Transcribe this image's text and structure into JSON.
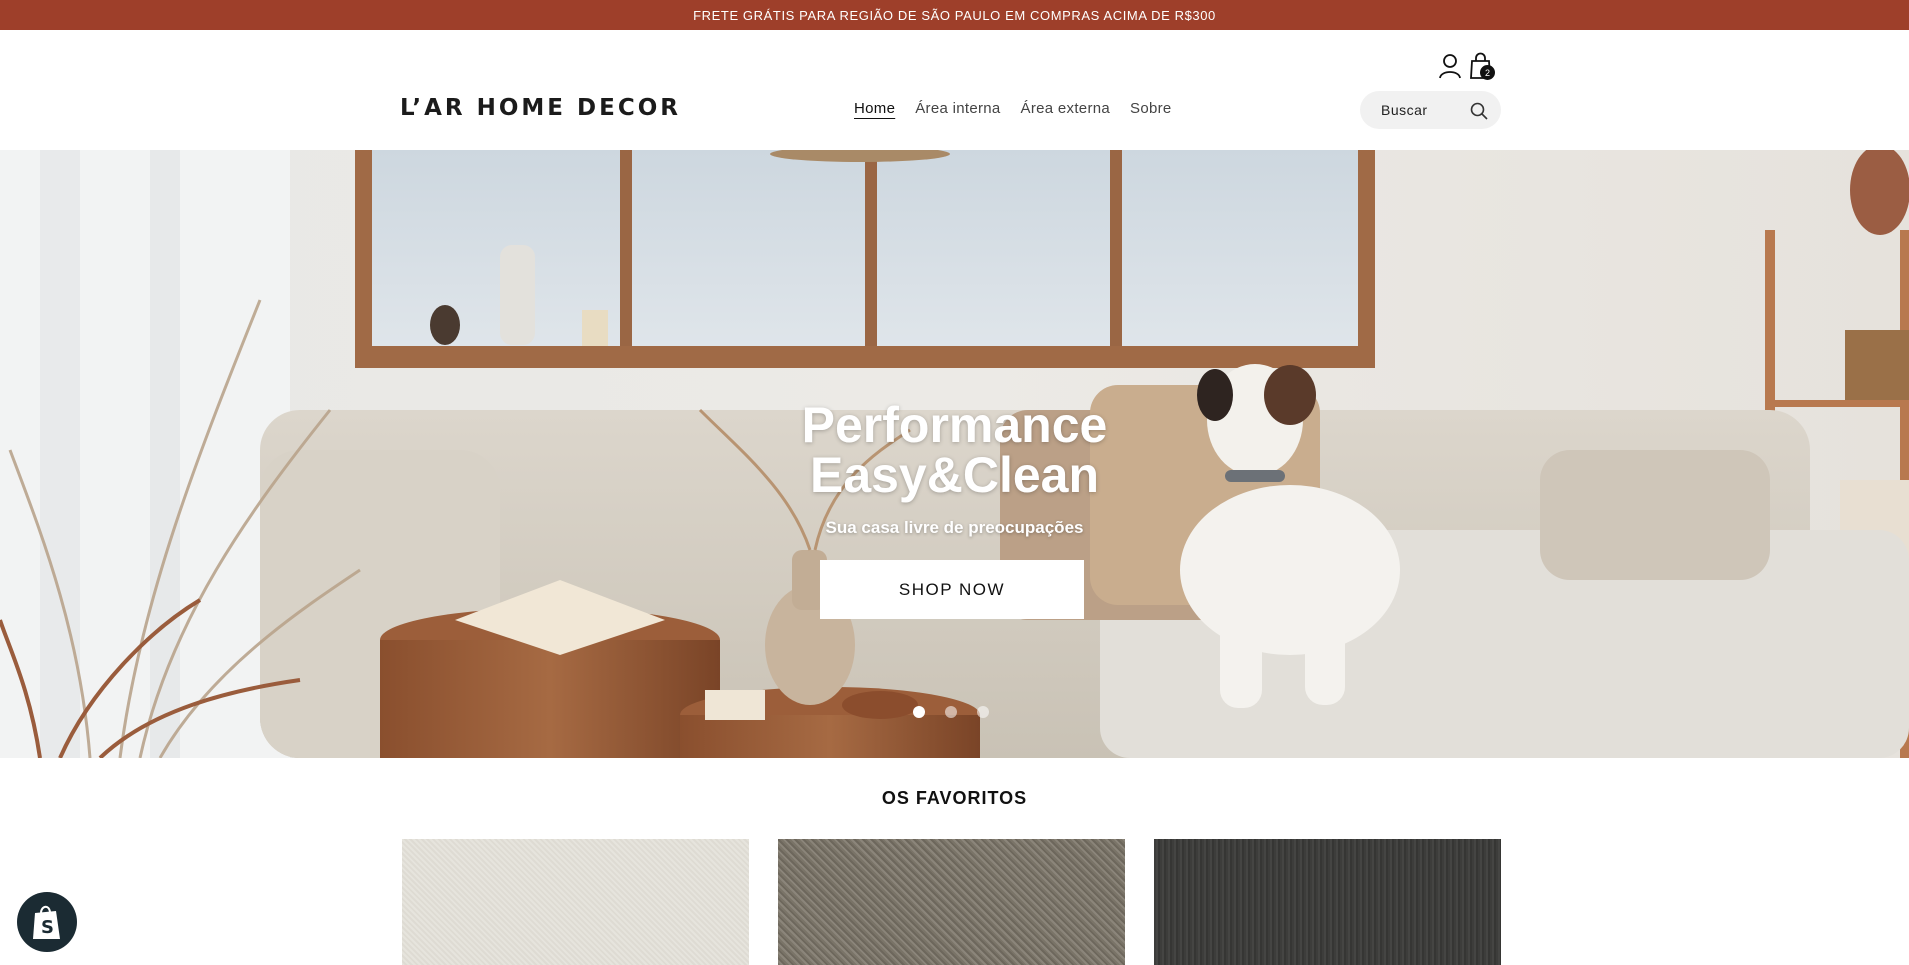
{
  "announcement": "FRETE GRÁTIS PARA REGIÃO DE SÃO PAULO EM COMPRAS ACIMA DE R$300",
  "header": {
    "logo": "L’AR HOME DECOR",
    "nav": [
      {
        "label": "Home",
        "active": true
      },
      {
        "label": "Área interna",
        "active": false
      },
      {
        "label": "Área externa",
        "active": false
      },
      {
        "label": "Sobre",
        "active": false
      }
    ],
    "search_placeholder": "Buscar",
    "cart_count": "2",
    "icons": [
      "user-icon",
      "shopping-bag-icon",
      "search-icon"
    ]
  },
  "hero": {
    "title_line1": "Performance",
    "title_line2": "Easy&Clean",
    "subtitle": "Sua casa livre de preocupações",
    "cta": "SHOP NOW",
    "slides": 3,
    "active_slide": 1
  },
  "favorites": {
    "title": "OS FAVORITOS",
    "products": [
      {
        "color": "#e3e0d8"
      },
      {
        "color": "#7d776b"
      },
      {
        "color": "#3e3e3c"
      }
    ]
  },
  "colors": {
    "announcement_bg": "#9e3f2a",
    "text": "#111111",
    "search_bg": "#f1f1f1"
  }
}
